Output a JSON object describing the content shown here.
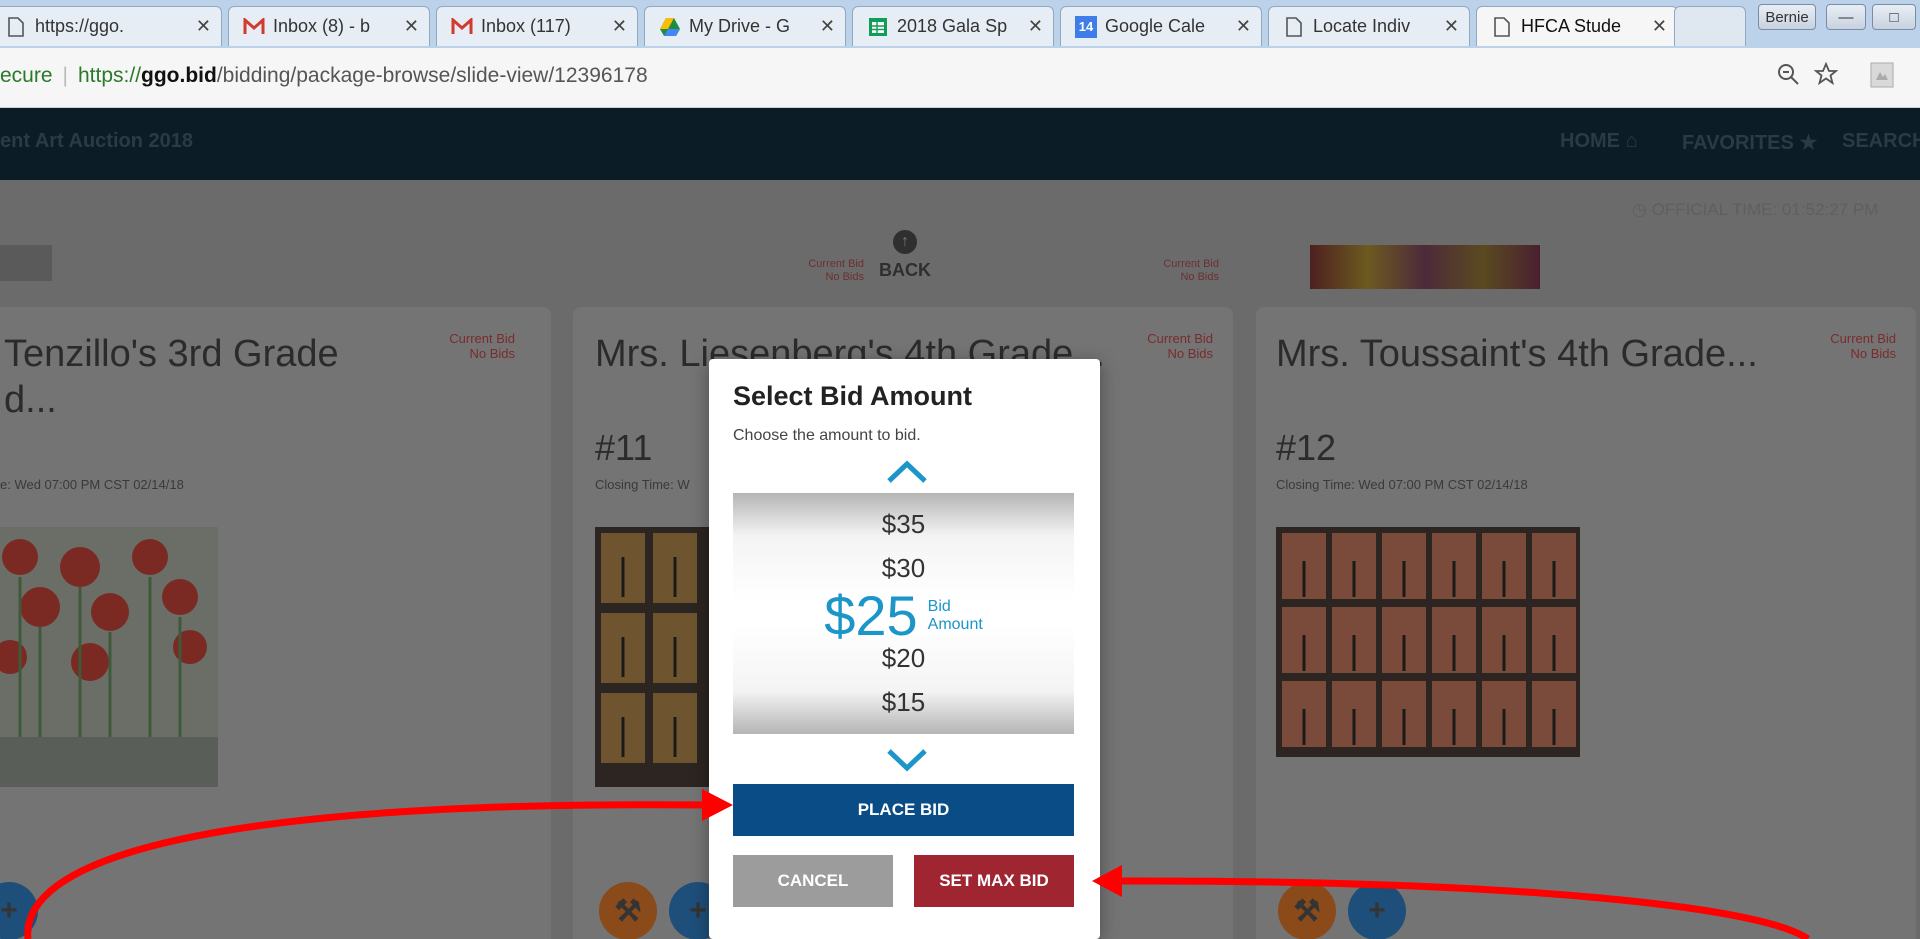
{
  "browser": {
    "tabs": [
      {
        "title": "https://ggo.",
        "icon": "page-icon"
      },
      {
        "title": "Inbox (8) - b",
        "icon": "gmail-icon"
      },
      {
        "title": "Inbox (117)",
        "icon": "gmail-icon"
      },
      {
        "title": "My Drive - G",
        "icon": "drive-icon"
      },
      {
        "title": "2018 Gala Sp",
        "icon": "sheets-icon"
      },
      {
        "title": "Google Cale",
        "icon": "calendar-icon",
        "badge": "14"
      },
      {
        "title": "Locate Indiv",
        "icon": "page-icon"
      },
      {
        "title": "HFCA Stude",
        "icon": "page-icon",
        "active": true
      }
    ],
    "close_glyph": "✕",
    "profile_name": "Bernie",
    "address": {
      "security": "ecure",
      "scheme": "https://",
      "host": "ggo.bid",
      "path": "/bidding/package-browse/slide-view/12396178"
    }
  },
  "site": {
    "title": "ent Art Auction 2018",
    "nav": {
      "home": "HOME",
      "favorites": "FAVORITES",
      "search": "SEARCH"
    },
    "official_time": "OFFICIAL TIME: 01:52:27 PM",
    "back_label": "BACK",
    "ghost_bids": {
      "left": {
        "label": "Current Bid",
        "value": "No Bids"
      },
      "right": {
        "label": "Current Bid",
        "value": "No Bids"
      }
    }
  },
  "cards": [
    {
      "title_line1": "Tenzillo's 3rd Grade",
      "title_line2": "d...",
      "current_bid_label": "Current Bid",
      "current_bid_value": "No Bids",
      "number": "",
      "closing": "e: Wed 07:00 PM CST 02/14/18"
    },
    {
      "title_line1": "Mrs. Liesenberg's 4th Grade...",
      "title_line2": "",
      "current_bid_label": "Current Bid",
      "current_bid_value": "No Bids",
      "number": "#11",
      "closing": "Closing Time: W"
    },
    {
      "title_line1": "Mrs. Toussaint's 4th Grade...",
      "title_line2": "",
      "current_bid_label": "Current Bid",
      "current_bid_value": "No Bids",
      "number": "#12",
      "closing": "Closing Time: Wed 07:00 PM CST 02/14/18"
    }
  ],
  "modal": {
    "title": "Select Bid Amount",
    "subtitle": "Choose the amount to bid.",
    "options_above": [
      "$35",
      "$30"
    ],
    "selected": "$25",
    "selected_label_1": "Bid",
    "selected_label_2": "Amount",
    "options_below": [
      "$20",
      "$15"
    ],
    "place_bid": "PLACE BID",
    "cancel": "CANCEL",
    "set_max_bid": "SET MAX BID"
  },
  "colors": {
    "accent_blue": "#0a4d86",
    "selected_blue": "#1c95c8",
    "max_bid_red": "#9f2631",
    "annotation_red": "#ff0000"
  }
}
